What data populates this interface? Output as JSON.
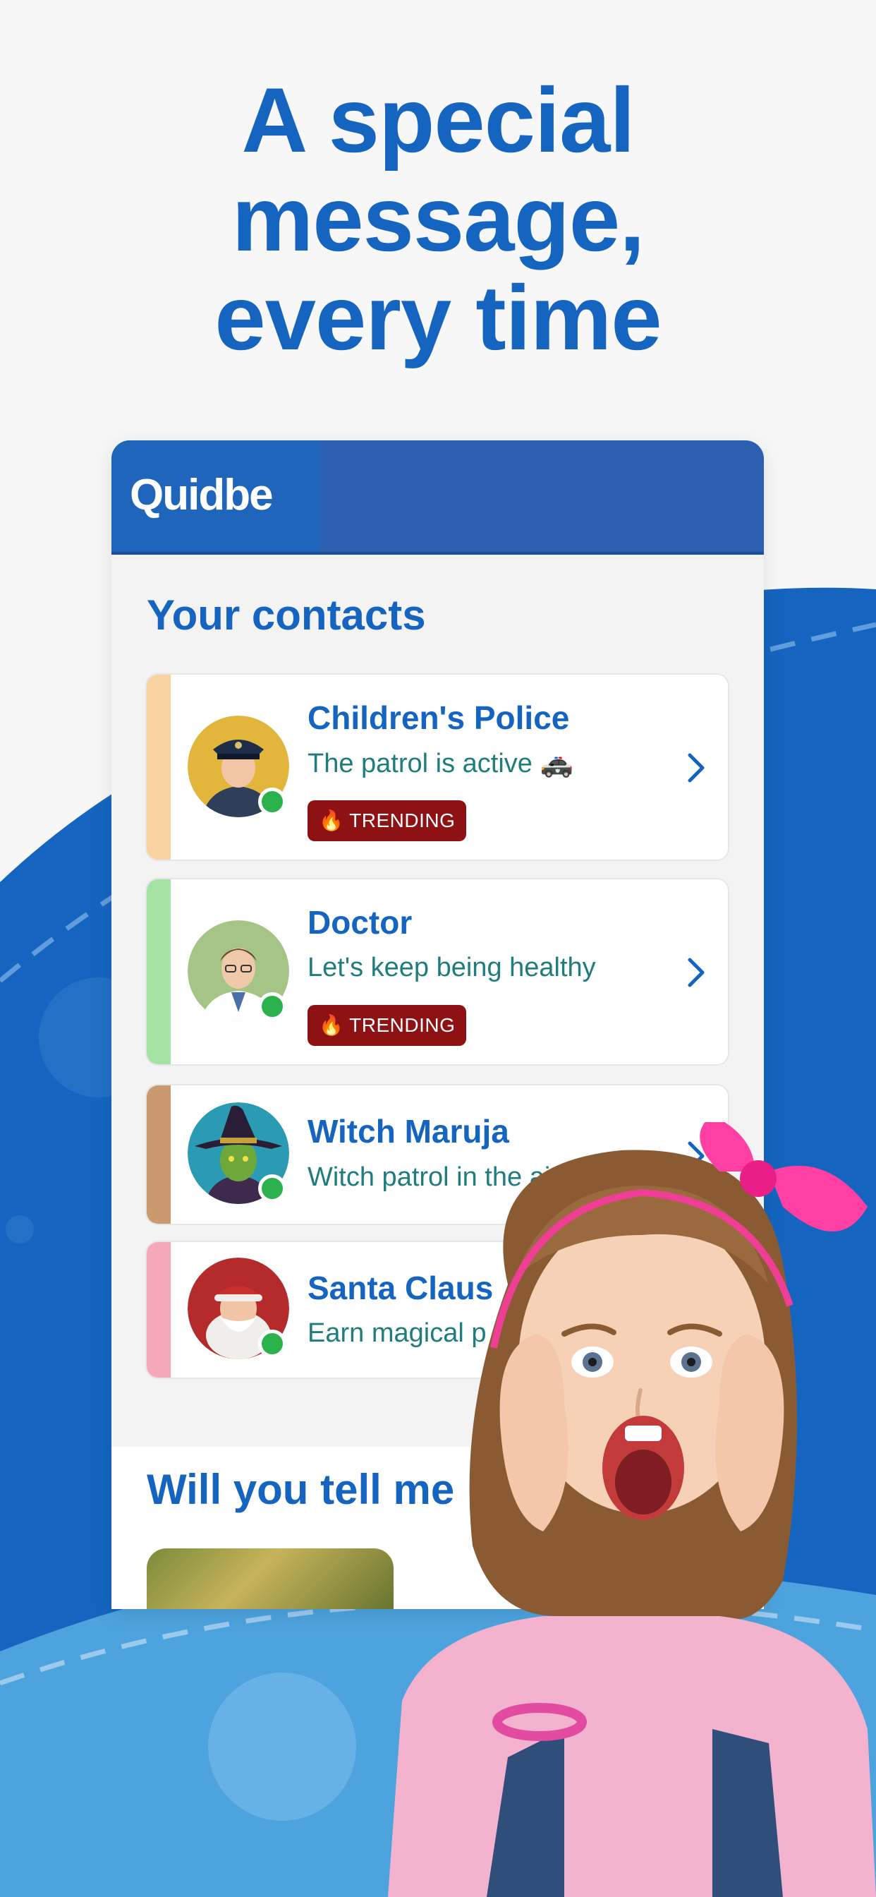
{
  "headline": {
    "line1": "A special",
    "line2": "message,",
    "line3": "every time"
  },
  "app": {
    "logo": "Quidbe"
  },
  "contacts_section": {
    "title": "Your contacts",
    "items": [
      {
        "name": "Children's Police",
        "message": "The patrol is active 🚓",
        "badge": "🔥 TRENDING",
        "color": "#f8d3a0"
      },
      {
        "name": "Doctor",
        "message": "Let's keep being healthy",
        "badge": "🔥 TRENDING",
        "color": "#a5e3a5"
      },
      {
        "name": "Witch Maruja",
        "message": "Witch patrol in the air 🧙",
        "color": "#c99a6e"
      },
      {
        "name": "Santa Claus",
        "message": "Earn magical p",
        "color": "#f5a9b8"
      }
    ]
  },
  "stories_section": {
    "title": "Will you tell me"
  },
  "colors": {
    "brand_blue": "#1565c0",
    "header_blue": "#2d5fb0",
    "trending_red": "#8e1214",
    "online_green": "#2bb24c"
  }
}
